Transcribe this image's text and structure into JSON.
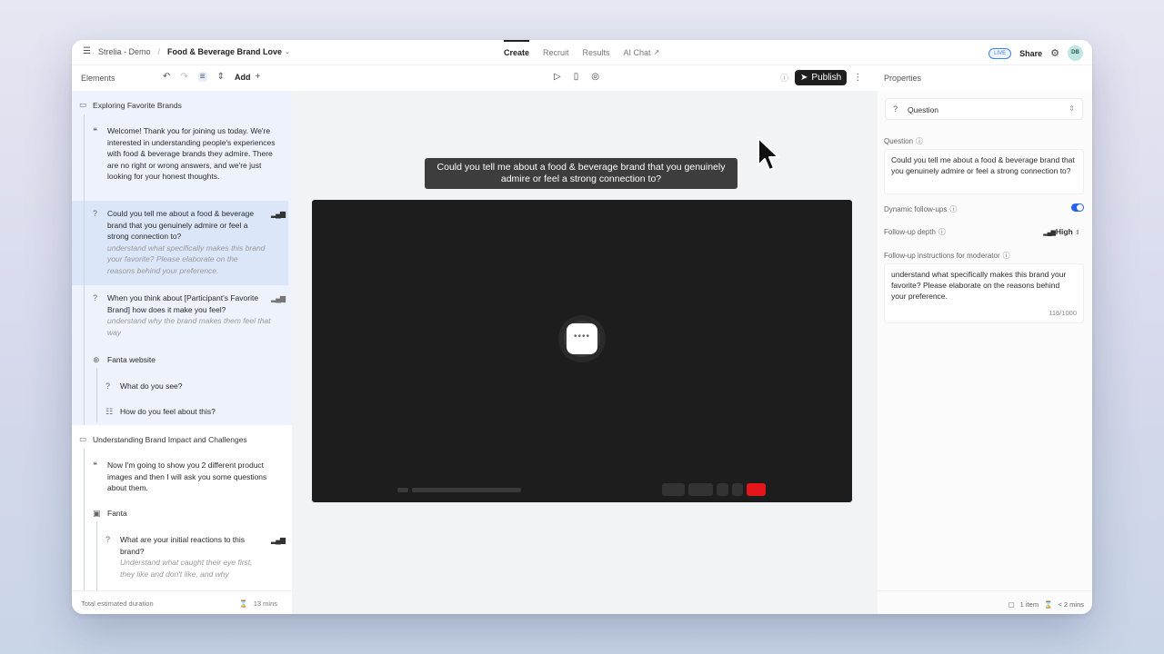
{
  "topbar": {
    "workspace": "Strelia - Demo",
    "separator": "/",
    "project": "Food & Beverage Brand Love",
    "tabs": [
      {
        "label": "Create"
      },
      {
        "label": "Recruit"
      },
      {
        "label": "Results"
      },
      {
        "label": "AI Chat"
      }
    ],
    "live_badge": "LIVE",
    "share_label": "Share",
    "avatar_initials": "DB"
  },
  "toolbar": {
    "elements_title": "Elements",
    "add_label": "Add",
    "publish_label": "Publish",
    "properties_title": "Properties"
  },
  "sidebar": {
    "section1": "Exploring Favorite Brands",
    "welcome": "Welcome! Thank you for joining us today. We're interested in understanding people's experiences with food & beverage brands they admire. There are no right or wrong answers, and we're just looking for your honest thoughts.",
    "q1": "Could you tell me about a food & beverage brand that you genuinely admire or feel a strong connection to?",
    "q1_note": "understand what specifically makes this brand your favorite? Please elaborate on the reasons behind your preference.",
    "q2": "When you think about [Participant's Favorite Brand] how does it make you feel?",
    "q2_note": "understand why the brand makes them feel that way",
    "website": "Fanta website",
    "web_q1": "What do you see?",
    "web_q2": "How do you feel about this?",
    "section2": "Understanding Brand Impact and Challenges",
    "intro2": "Now I'm going to show you 2 different product images and then I will ask you some questions about them.",
    "image": "Fanta",
    "img_q1": "What are your initial reactions to this brand?",
    "img_q1_note": "Understand what caught their eye first, they like and don't like, and why",
    "footer_label": "Total estimated duration",
    "footer_value": "13 mins"
  },
  "canvas": {
    "caption": "Could you tell me about a food & beverage brand that you genuinely admire or feel a strong connection to?",
    "loader_text": "••••"
  },
  "properties": {
    "type_label": "Question",
    "question_label": "Question",
    "question_text": "Could you tell me about a food & beverage brand that you genuinely admire or feel a strong connection to?",
    "dynamic_label": "Dynamic follow-ups",
    "dynamic_on": true,
    "depth_label": "Follow-up depth",
    "depth_value": "High",
    "instructions_label": "Follow-up instructions for moderator",
    "instructions_text": "understand what specifically makes this brand your favorite? Please elaborate on the reasons behind your preference.",
    "counter": "116/1000",
    "footer_items": "1 item",
    "footer_time": "< 2 mins"
  },
  "colors": {
    "accent": "#2563eb",
    "record": "#e4161b",
    "selection": "#dbe6f8"
  }
}
